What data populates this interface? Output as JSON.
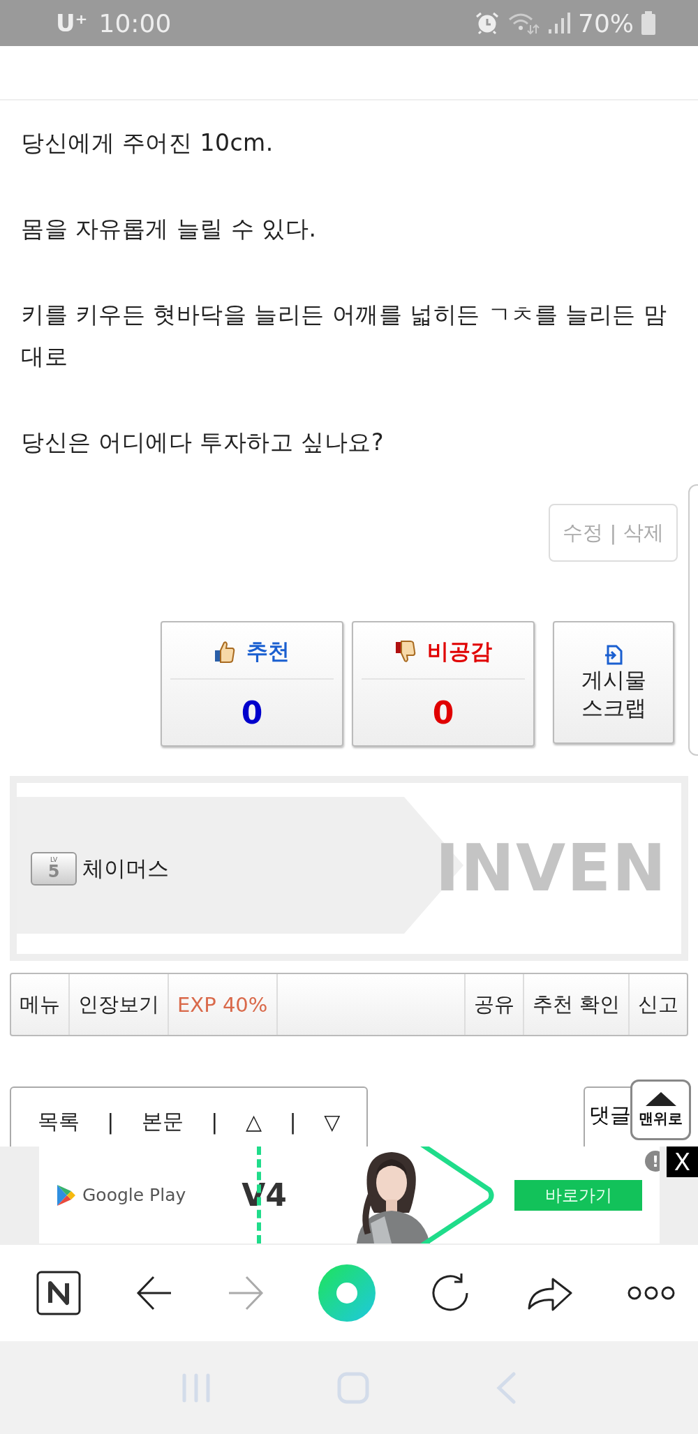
{
  "status_bar": {
    "carrier": "U⁺",
    "time": "10:00",
    "battery": "70%"
  },
  "post": {
    "paragraphs": [
      "당신에게 주어진 10cm.",
      "몸을 자유롭게 늘릴 수 있다.",
      "키를 키우든 혓바닥을 늘리든 어깨를 넓히든 ㄱㅊ를 늘리든 맘대로",
      "당신은 어디에다 투자하고 싶나요?"
    ]
  },
  "edit_actions": {
    "edit": "수정",
    "separator": "|",
    "delete": "삭제"
  },
  "votes": [
    {
      "kind": "up",
      "label": "추천",
      "count": "0"
    },
    {
      "kind": "down",
      "label": "비공감",
      "count": "0"
    }
  ],
  "scrap": {
    "lines": [
      "게시물",
      "스크랩"
    ]
  },
  "author": {
    "level_tag": "LV",
    "level": "5",
    "name": "체이머스",
    "site_logo": "INVEN"
  },
  "menu_bar": [
    {
      "kind": "link",
      "label": "메뉴"
    },
    {
      "kind": "link",
      "label": "인장보기"
    },
    {
      "kind": "exp",
      "label": "EXP 40%"
    },
    {
      "kind": "spacer"
    },
    {
      "kind": "link",
      "label": "공유"
    },
    {
      "kind": "link",
      "label": "추천 확인"
    },
    {
      "kind": "link",
      "label": "신고"
    }
  ],
  "nav": {
    "items": [
      "목록",
      "본문",
      "△",
      "▽"
    ],
    "separator": "|"
  },
  "comment_button": "댓글",
  "top_button": "맨위로",
  "ad": {
    "store": "Google Play",
    "title": "V4",
    "cta": "바로가기",
    "info": "!",
    "close": "X"
  },
  "browser_toolbar": {
    "forward_enabled": false
  }
}
